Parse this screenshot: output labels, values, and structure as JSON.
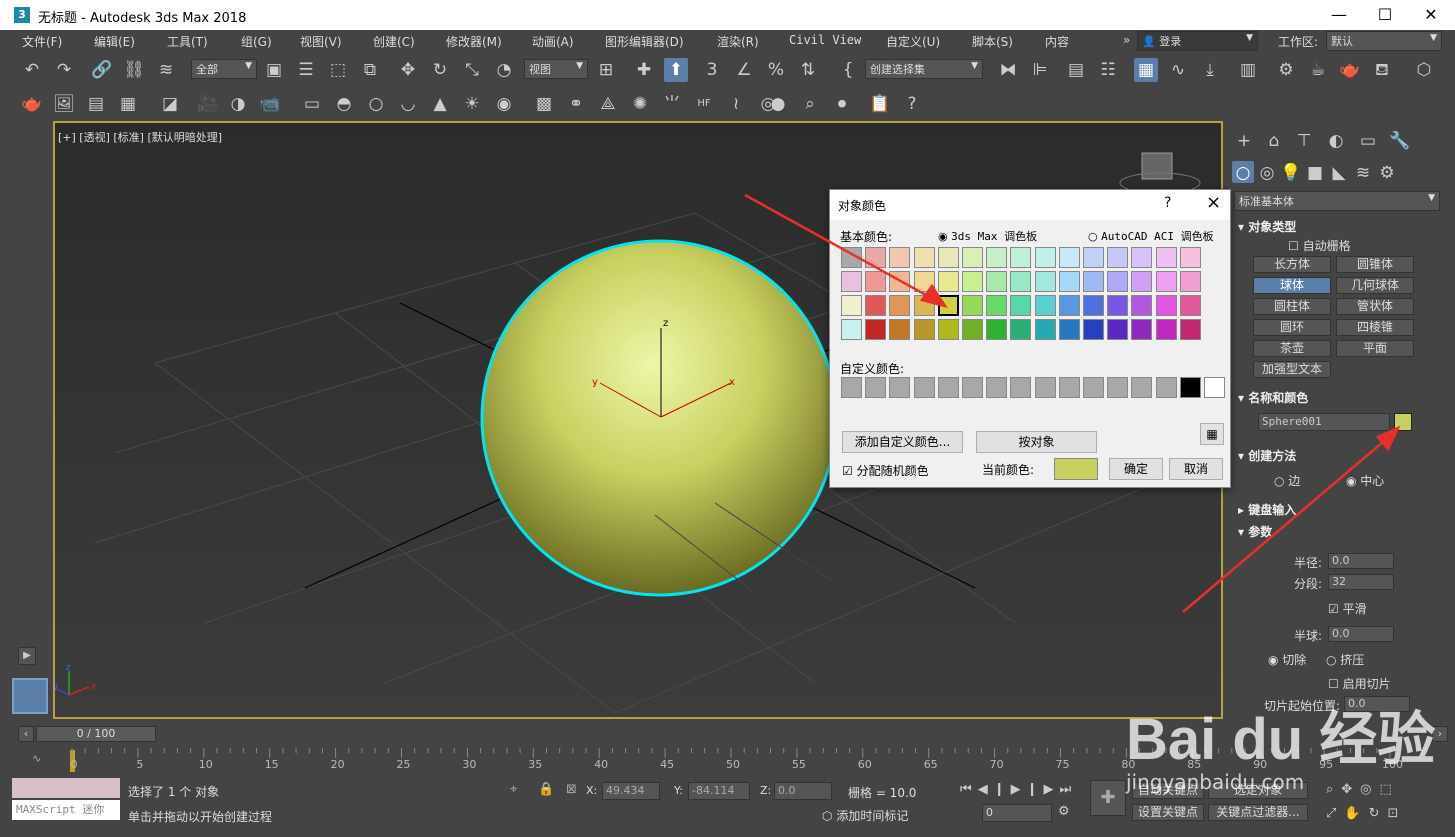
{
  "window": {
    "title": "无标题 - Autodesk 3ds Max 2018",
    "app_icon": "3ds-max-icon",
    "controls": [
      "minimize",
      "maximize",
      "close"
    ]
  },
  "menu": {
    "items": [
      "文件(F)",
      "编辑(E)",
      "工具(T)",
      "组(G)",
      "视图(V)",
      "创建(C)",
      "修改器(M)",
      "动画(A)",
      "图形编辑器(D)",
      "渲染(R)",
      "Civil View",
      "自定义(U)",
      "脚本(S)",
      "内容"
    ],
    "login": "登录",
    "workspace_label": "工作区:",
    "workspace_value": "默认"
  },
  "toolbar": {
    "selection_filter": "全部",
    "ref_coord": "视图",
    "named_selection": "创建选择集"
  },
  "viewport": {
    "label": "[+] [透视] [标准] [默认明暗处理]",
    "object_color": "#c8d060",
    "selection_color": "#00e5ee",
    "axes": {
      "x": "x",
      "y": "y",
      "z": "z"
    }
  },
  "command_panel": {
    "category": "标准基本体",
    "object_type": {
      "title": "对象类型",
      "autogrid": "自动栅格",
      "buttons": [
        "长方体",
        "圆锥体",
        "球体",
        "几何球体",
        "圆柱体",
        "管状体",
        "圆环",
        "四棱锥",
        "茶壶",
        "平面",
        "加强型文本"
      ],
      "selected": "球体"
    },
    "name_color": {
      "title": "名称和颜色",
      "name": "Sphere001",
      "color": "#c8d060"
    },
    "creation_method": {
      "title": "创建方法",
      "edge": "边",
      "center": "中心"
    },
    "keyboard": {
      "title": "键盘输入"
    },
    "params": {
      "title": "参数",
      "radius_label": "半径:",
      "radius": "0.0",
      "segments_label": "分段:",
      "segments": "32",
      "smooth": "平滑",
      "hemisphere_label": "半球:",
      "hemisphere": "0.0",
      "chop": "切除",
      "squash": "挤压",
      "enable_slice": "启用切片",
      "slice_from": "切片起始位置:",
      "slice_from_val": "0.0"
    }
  },
  "dialog": {
    "title": "对象颜色",
    "help": "?",
    "close": "×",
    "basic_colors": "基本颜色:",
    "palette_max": "3ds Max 调色板",
    "palette_acad": "AutoCAD ACI 调色板",
    "custom_colors": "自定义颜色:",
    "add_custom": "添加自定义颜色...",
    "by_object": "按对象",
    "random": "分配随机颜色",
    "current_color": "当前颜色:",
    "current_value": "#c8d060",
    "ok": "确定",
    "cancel": "取消",
    "swatches": [
      [
        "#a8a8a8",
        "#e8a8a8",
        "#f0c8b0",
        "#f0e0b0",
        "#e8e8b8",
        "#d8f0b8",
        "#c8f0c8",
        "#c0f0d8",
        "#c0f0e8",
        "#c8e8f8",
        "#c0d0f8",
        "#c8c8f8",
        "#d8c0f8",
        "#f0c0f0",
        "#f8c0e0"
      ],
      [
        "#e8c0e0",
        "#f09898",
        "#f0b890",
        "#f0d890",
        "#e8e890",
        "#c8f090",
        "#a8e8a8",
        "#98e8c8",
        "#a0e8e0",
        "#a8d8f8",
        "#a0b8f8",
        "#b0a8f8",
        "#d0a0f8",
        "#f0a0f0",
        "#f0a0d0"
      ],
      [
        "#f0f0d0",
        "#e05858",
        "#e09858",
        "#d8b850",
        "#d0d040",
        "#98d858",
        "#68d868",
        "#58d8a8",
        "#58d0d0",
        "#5898e0",
        "#5070e0",
        "#7858e0",
        "#b058e0",
        "#e058e0",
        "#e05898"
      ],
      [
        "#c8f0f0",
        "#c02828",
        "#c07828",
        "#b89828",
        "#b0b820",
        "#70b028",
        "#30b030",
        "#28b078",
        "#28a8b0",
        "#2878c0",
        "#2840c0",
        "#5828c0",
        "#9028c0",
        "#c028c0",
        "#c02870"
      ]
    ],
    "selected_swatch": [
      2,
      4
    ],
    "custom_swatches": [
      "#a8a8a8",
      "#a8a8a8",
      "#a8a8a8",
      "#a8a8a8",
      "#a8a8a8",
      "#a8a8a8",
      "#a8a8a8",
      "#a8a8a8",
      "#a8a8a8",
      "#a8a8a8",
      "#a8a8a8",
      "#a8a8a8",
      "#a8a8a8",
      "#a8a8a8",
      "#000000",
      "#ffffff"
    ]
  },
  "timeline": {
    "frame": "0 / 100",
    "ticks": [
      "0",
      "5",
      "10",
      "15",
      "20",
      "25",
      "30",
      "35",
      "40",
      "45",
      "50",
      "55",
      "60",
      "65",
      "70",
      "75",
      "80",
      "85",
      "90",
      "95",
      "100"
    ]
  },
  "status": {
    "maxscript": "MAXScript 迷你",
    "selected": "选择了 1 个 对象",
    "hint": "单击并拖动以开始创建过程",
    "x_label": "X:",
    "x": "49.434",
    "y_label": "Y:",
    "y": "-84.114",
    "z_label": "Z:",
    "z": "0.0",
    "grid": "栅格 = 10.0",
    "add_time_tag": "添加时间标记",
    "set_key": "设置关键点",
    "key_filter": "关键点过滤器...",
    "autokey": "自动关键点",
    "selected_obj": "选定对象",
    "frame_field": "0"
  },
  "watermark": {
    "text": "Bai du 经验",
    "url": "jingyanbaidu.com"
  }
}
